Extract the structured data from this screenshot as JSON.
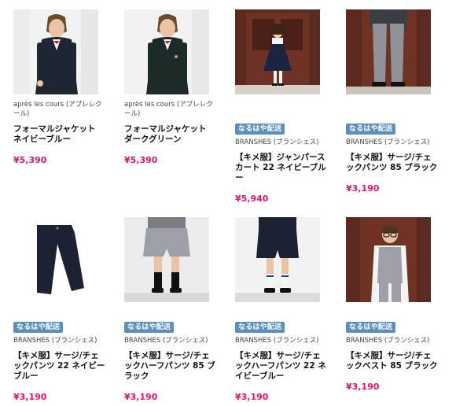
{
  "products": [
    {
      "badge": "",
      "brand": "après les cours (アプレレクール)",
      "name": "フォーマルジャケット ネイビーブルー",
      "price": "¥5,390",
      "icon": "boy-navy-jacket-photo"
    },
    {
      "badge": "",
      "brand": "après les cours (アプレレクール)",
      "name": "フォーマルジャケット ダークグリーン",
      "price": "¥5,390",
      "icon": "boy-green-jacket-photo"
    },
    {
      "badge": "なるはや配送",
      "brand": "BRANSHES (ブランシェス)",
      "name": "【キメ服】ジャンパースカート 22 ネイビーブルー",
      "price": "¥5,940",
      "icon": "girl-jumper-skirt-photo"
    },
    {
      "badge": "なるはや配送",
      "brand": "BRANSHES (ブランシェス)",
      "name": "【キメ服】サージ/チェックパンツ 85 ブラック",
      "price": "¥3,190",
      "icon": "check-pants-legs-photo"
    },
    {
      "badge": "なるはや配送",
      "brand": "BRANSHES (ブランシェス)",
      "name": "【キメ服】サージ/チェックパンツ 22 ネイビーブルー",
      "price": "¥3,190",
      "icon": "navy-pants-photo"
    },
    {
      "badge": "なるはや配送",
      "brand": "BRANSHES (ブランシェス)",
      "name": "【キメ服】サージ/チェックハーフパンツ 85 ブラック",
      "price": "¥3,190",
      "icon": "check-half-pants-photo"
    },
    {
      "badge": "なるはや配送",
      "brand": "BRANSHES (ブランシェス)",
      "name": "【キメ服】サージ/チェックハーフパンツ 22 ネイビーブルー",
      "price": "¥3,190",
      "icon": "navy-half-pants-photo"
    },
    {
      "badge": "なるはや配送",
      "brand": "BRANSHES (ブランシェス)",
      "name": "【キメ服】サージ/チェックベスト 85 ブラック",
      "price": "¥3,190",
      "icon": "boy-check-vest-photo"
    }
  ],
  "colors": {
    "price": "#e0156b",
    "badge": "#5b8fbf"
  }
}
